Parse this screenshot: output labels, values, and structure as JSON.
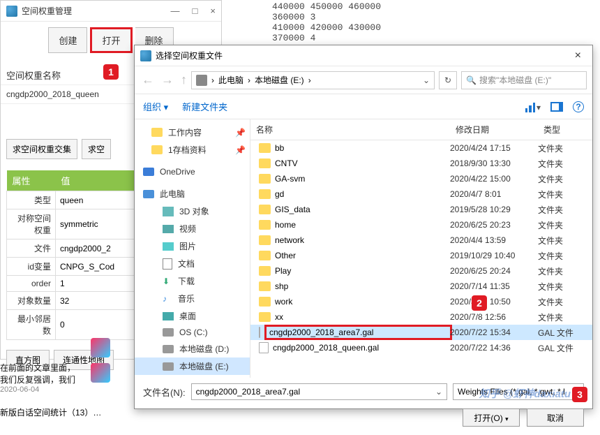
{
  "parent": {
    "title": "空间权重管理",
    "sys_min": "—",
    "sys_max": "□",
    "sys_close": "×",
    "toolbar": {
      "create": "创建",
      "open": "打开",
      "delete": "删除"
    },
    "weight_name_label": "空间权重名称",
    "weight_name_value": "cngdp2000_2018_queen",
    "ops": {
      "intersect": "求空间权重交集",
      "other": "求空"
    },
    "prop_headers": {
      "attr": "属性",
      "val": "值"
    },
    "props": [
      {
        "k": "类型",
        "v": "queen"
      },
      {
        "k": "对称空间权重",
        "v": "symmetric"
      },
      {
        "k": "文件",
        "v": "cngdp2000_2"
      },
      {
        "k": "id变量",
        "v": "CNPG_S_Cod"
      },
      {
        "k": "order",
        "v": "1"
      },
      {
        "k": "对象数量",
        "v": "32"
      },
      {
        "k": "最小邻居数",
        "v": "0"
      }
    ],
    "buttons": {
      "hist": "直方图",
      "connmap": "连通性地图"
    }
  },
  "bg_numbers": "440000 450000 460000\n360000 3\n410000 420000 430000\n370000 4",
  "articles": {
    "a1_l1": "在前面的文章里面，",
    "a1_l2": "我们反复强调，我们",
    "a1_date": "2020-06-04",
    "a2": "新版白话空间统计（13）…"
  },
  "dialog": {
    "title": "选择空间权重文件",
    "breadcrumb": {
      "pc": "此电脑",
      "drive": "本地磁盘 (E:)",
      "sep": "›"
    },
    "refresh": "↻",
    "search_placeholder": "搜索\"本地磁盘 (E:)\"",
    "tb_org": "组织 ▾",
    "tb_new": "新建文件夹",
    "help": "?",
    "tree": {
      "work": "工作内容",
      "archive": "1存档资料",
      "onedrive": "OneDrive",
      "thispc": "此电脑",
      "obj3d": "3D 对象",
      "video": "视频",
      "pics": "图片",
      "docs": "文档",
      "dl": "下载",
      "music": "音乐",
      "desktop": "桌面",
      "os": "OS (C:)",
      "diskD": "本地磁盘 (D:)",
      "diskE": "本地磁盘 (E:)",
      "pin": "📌"
    },
    "headers": {
      "name": "名称",
      "date": "修改日期",
      "type": "类型"
    },
    "files": [
      {
        "name": "bb",
        "date": "2020/4/24 17:15",
        "type": "文件夹",
        "folder": true
      },
      {
        "name": "CNTV",
        "date": "2018/9/30 13:30",
        "type": "文件夹",
        "folder": true
      },
      {
        "name": "GA-svm",
        "date": "2020/4/22 15:00",
        "type": "文件夹",
        "folder": true
      },
      {
        "name": "gd",
        "date": "2020/4/7 8:01",
        "type": "文件夹",
        "folder": true
      },
      {
        "name": "GIS_data",
        "date": "2019/5/28 10:29",
        "type": "文件夹",
        "folder": true
      },
      {
        "name": "home",
        "date": "2020/6/25 20:23",
        "type": "文件夹",
        "folder": true
      },
      {
        "name": "network",
        "date": "2020/4/4 13:59",
        "type": "文件夹",
        "folder": true
      },
      {
        "name": "Other",
        "date": "2019/10/29 10:40",
        "type": "文件夹",
        "folder": true
      },
      {
        "name": "Play",
        "date": "2020/6/25 20:24",
        "type": "文件夹",
        "folder": true
      },
      {
        "name": "shp",
        "date": "2020/7/14 11:35",
        "type": "文件夹",
        "folder": true
      },
      {
        "name": "work",
        "date": "2020/3/30 10:50",
        "type": "文件夹",
        "folder": true
      },
      {
        "name": "xx",
        "date": "2020/7/8 12:56",
        "type": "文件夹",
        "folder": true
      },
      {
        "name": "cngdp2000_2018_area7.gal",
        "date": "2020/7/22 15:34",
        "type": "GAL 文件",
        "folder": false,
        "selected": true,
        "boxed": true
      },
      {
        "name": "cngdp2000_2018_queen.gal",
        "date": "2020/7/22 14:36",
        "type": "GAL 文件",
        "folder": false
      }
    ],
    "filename_label": "文件名(N):",
    "filename_value": "cngdp2000_2018_area7.gal",
    "filter": "Weights Files (*.gal, *.gwt, *.l",
    "open_btn": "打开(O)",
    "cancel_btn": "取消"
  },
  "markers": {
    "m1": "1",
    "m2": "2",
    "m3": "3"
  },
  "watermark": "知乎 @虾神daxiatu"
}
